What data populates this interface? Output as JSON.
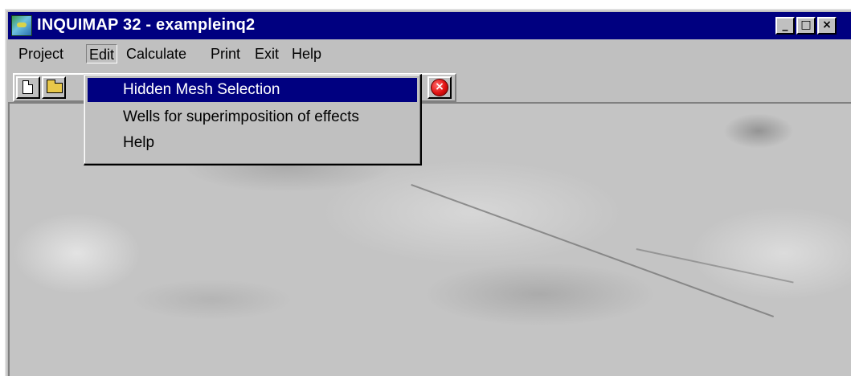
{
  "window": {
    "title": "INQUIMAP 32 - exampleinq2",
    "controls": {
      "minimize": "_",
      "maximize": "□",
      "close": "×"
    }
  },
  "menubar": {
    "items": [
      {
        "label": "Project"
      },
      {
        "label": "Edit"
      },
      {
        "label": "Calculate"
      },
      {
        "label": "Print"
      },
      {
        "label": "Exit"
      },
      {
        "label": "Help"
      }
    ]
  },
  "toolbar": {
    "buttons": [
      {
        "icon": "new-document-icon"
      },
      {
        "icon": "open-folder-icon"
      },
      {
        "icon": "exit-icon",
        "glyph": "×"
      }
    ]
  },
  "edit_menu": {
    "items": [
      {
        "label": "Hidden Mesh Selection",
        "selected": true
      },
      {
        "label": "Wells for superimposition of effects",
        "selected": false
      },
      {
        "label": "Help",
        "selected": false
      }
    ]
  },
  "colors": {
    "titlebar": "#000080",
    "chrome": "#c0c0c0",
    "selection": "#000080"
  }
}
